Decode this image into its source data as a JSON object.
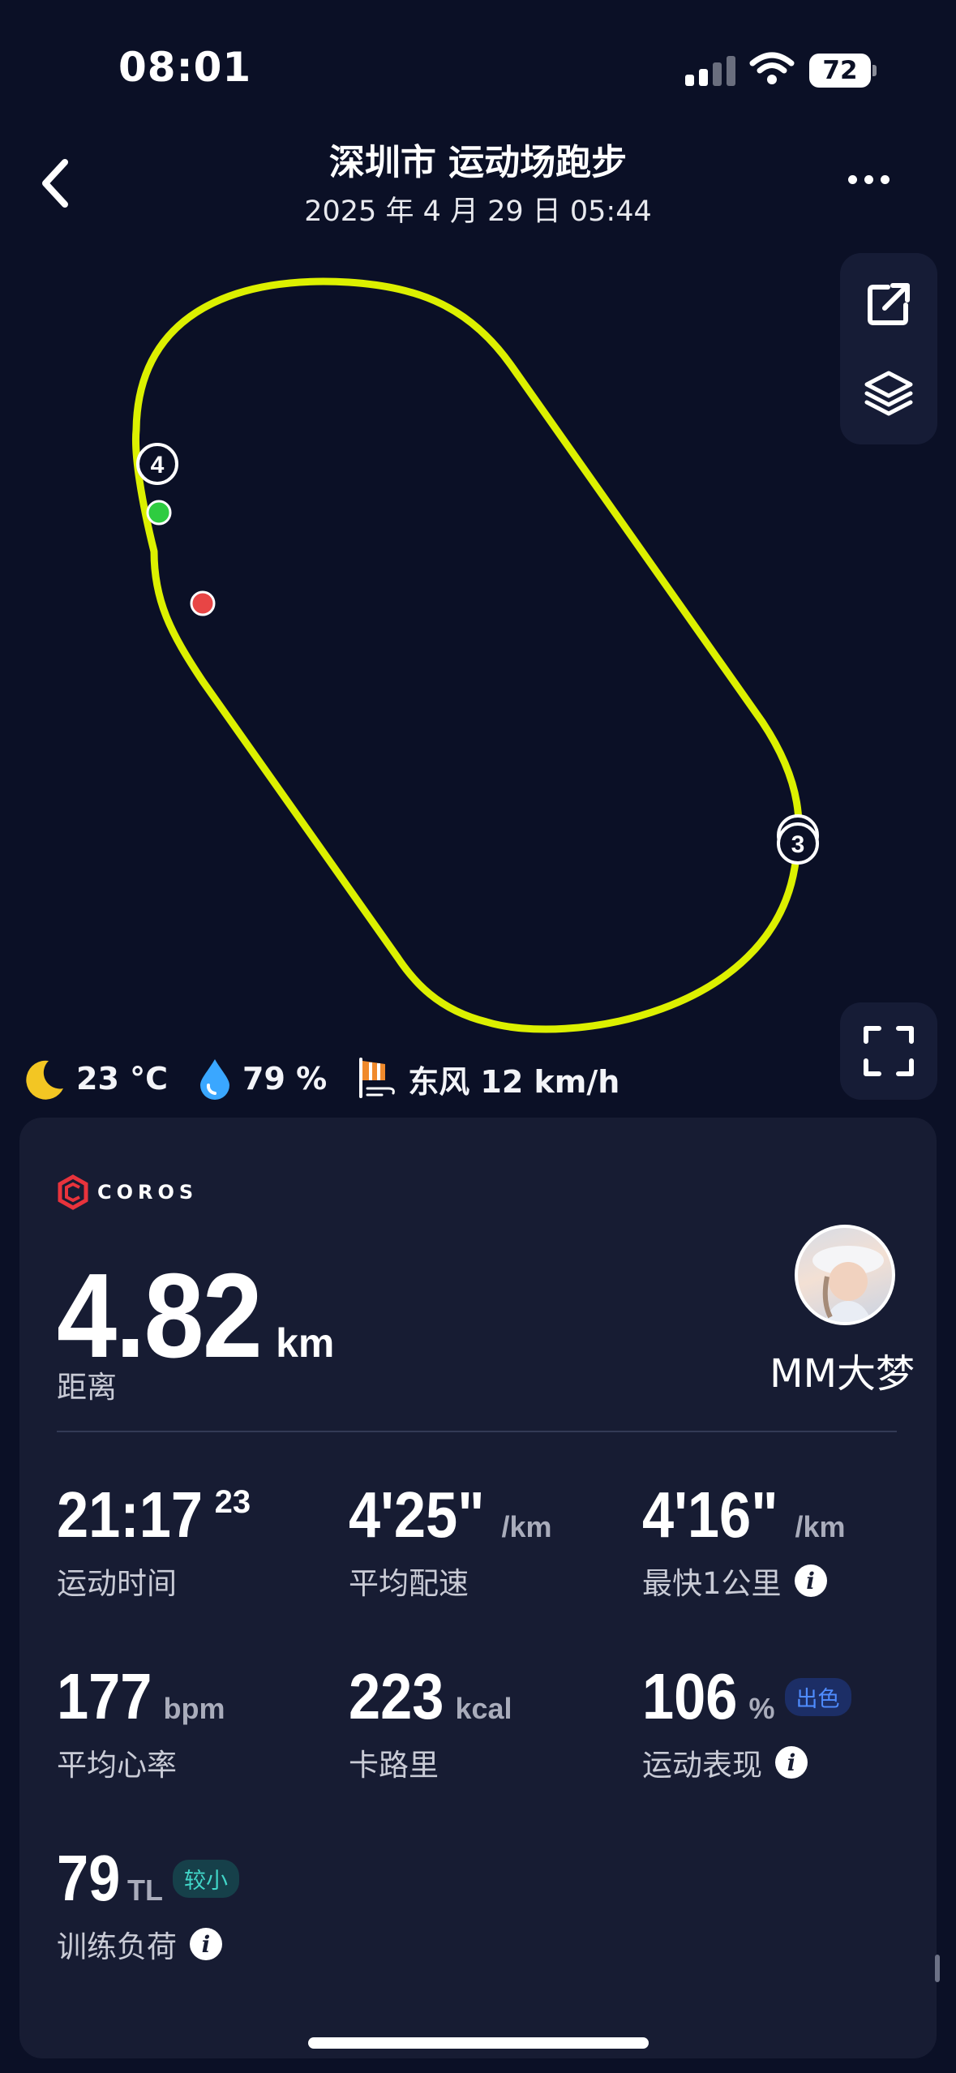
{
  "status_bar": {
    "time": "08:01",
    "battery": "72"
  },
  "header": {
    "title": "深圳市 运动场跑步",
    "subtitle": "2025 年 4 月 29 日 05:44"
  },
  "map": {
    "markers": [
      "4",
      "3"
    ],
    "track_color": "#dcf000"
  },
  "weather": {
    "temperature": "23 °C",
    "humidity": "79 %",
    "wind": "东风 12 km/h"
  },
  "card": {
    "brand": "COROS",
    "distance": {
      "value": "4.82",
      "unit": "km",
      "label": "距离"
    },
    "user": {
      "name": "MM大梦"
    },
    "metrics": {
      "duration": {
        "value": "21:17",
        "sup": "23",
        "label": "运动时间"
      },
      "avg_pace": {
        "value": "4'25\"",
        "unit": "/km",
        "label": "平均配速"
      },
      "fastest_km": {
        "value": "4'16\"",
        "unit": "/km",
        "label": "最快1公里"
      },
      "avg_hr": {
        "value": "177",
        "unit": "bpm",
        "label": "平均心率"
      },
      "calories": {
        "value": "223",
        "unit": "kcal",
        "label": "卡路里"
      },
      "performance": {
        "value": "106",
        "unit": "%",
        "badge": "出色",
        "label": "运动表现"
      },
      "training_load": {
        "value": "79",
        "unit": "TL",
        "badge": "较小",
        "label": "训练负荷"
      }
    },
    "info_glyph": "i"
  },
  "colors": {
    "background": "#0b1026",
    "card": "#171c33",
    "track": "#dcf000",
    "start": "#2ecc40",
    "end": "#e84545"
  }
}
